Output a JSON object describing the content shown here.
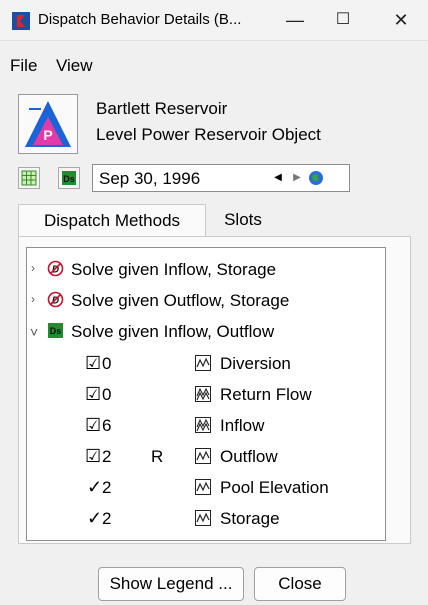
{
  "window": {
    "title": "Dispatch Behavior Details (B...",
    "minimize": "—",
    "maximize": "☐",
    "close": "✕"
  },
  "menu": {
    "file": "File",
    "view": "View"
  },
  "object": {
    "name": "Bartlett Reservoir",
    "type": "Level Power Reservoir Object",
    "icon_letter": "P"
  },
  "toolbar": {
    "date": "Sep 30, 1996",
    "prev": "◀",
    "next": "▶"
  },
  "tabs": {
    "dispatch_methods": "Dispatch Methods",
    "slots": "Slots"
  },
  "methods": [
    {
      "label": "Solve given Inflow, Storage",
      "chevron": "›",
      "icon": "D",
      "status": "disabled"
    },
    {
      "label": "Solve given Outflow, Storage",
      "chevron": "›",
      "icon": "D",
      "status": "disabled"
    },
    {
      "label": "Solve given Inflow, Outflow",
      "chevron": "˅",
      "icon": "Ds",
      "status": "active"
    }
  ],
  "slots": [
    {
      "check": "☑",
      "value": "0",
      "flag": "",
      "label": "Diversion"
    },
    {
      "check": "☑",
      "value": "0",
      "flag": "",
      "label": "Return Flow"
    },
    {
      "check": "☑",
      "value": "6",
      "flag": "",
      "label": "Inflow"
    },
    {
      "check": "☑",
      "value": "2",
      "flag": "R",
      "label": "Outflow"
    },
    {
      "check": "✓",
      "value": "2",
      "flag": "",
      "label": "Pool Elevation"
    },
    {
      "check": "✓",
      "value": "2",
      "flag": "",
      "label": "Storage"
    }
  ],
  "buttons": {
    "legend": "Show Legend ...",
    "close": "Close"
  },
  "colors": {
    "accent_blue": "#1155cc",
    "reservoir_pink": "#e23aa8",
    "dispatch_green": "#1e8f2e",
    "disabled_red": "#c8102e"
  }
}
